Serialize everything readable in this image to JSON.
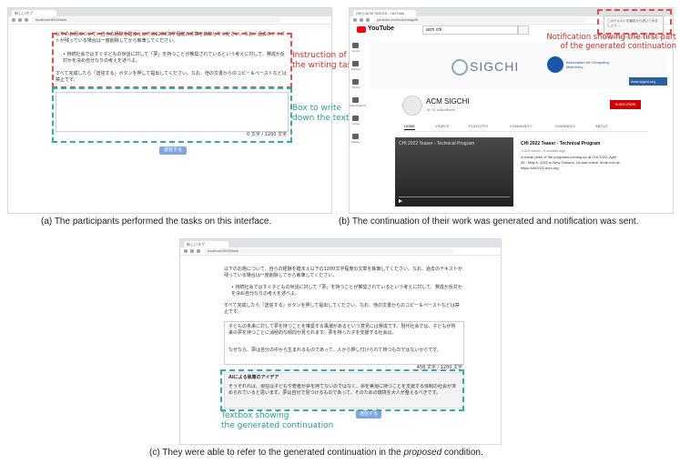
{
  "panel_a": {
    "browser": {
      "tab_label": "新しいタブ",
      "url": "localhost:8000/task"
    },
    "task_text_1": "以下のお題について、自らの経験を踏まえ以下の1200文字程度の文章を執筆してください。なお、過去のテキストが残っている場合は一度削除してから執筆してください。",
    "task_bullet": "持続社会ではすぐ子どもの世話に対して「夢」を持つことが推奨されているという考えに対して、賛成か反対かを決め自分なりの考えを述べよ。",
    "task_text_2": "すべて完成したら「送信する」ボタンを押して提出してください。なお、他の文書からのコピー＆ペーストなどは禁止です。",
    "counter": "0 文字 / 1200 文字",
    "submit_label": "送信する",
    "annotation_instruction": "Instruction of\nthe writing task",
    "annotation_textbox": "Box to write\ndown the text",
    "caption": "(a) The participants performed the tasks on this interface."
  },
  "panel_b": {
    "browser": {
      "tab_label": "(99+) ACM SIGCHI - YouTube",
      "url": "youtube.com/c/acmsigchi"
    },
    "search_value": "acm chi",
    "logo_text": "YouTube",
    "sidebar": [
      "Home",
      "Explore",
      "Shorts",
      "Subscriptions",
      "Library",
      "History"
    ],
    "banner_brand": "SIGCHI",
    "banner_acm": "Association for Computing Machinery",
    "banner_url": "www.sigchi.org",
    "channel_name": "ACM SIGCHI",
    "subscribers": "15.7K subscribers",
    "subscribe_label": "SUBSCRIBE",
    "tabs": [
      "HOME",
      "VIDEOS",
      "PLAYLISTS",
      "COMMUNITY",
      "CHANNELS",
      "ABOUT"
    ],
    "video_title": "CHI 2022 Teaser - Technical Program",
    "video_overlay": "CHI 2022 Teaser - Technical Program",
    "video_meta": "1,529 views • 6 months ago",
    "video_desc": "A sneak peek of the programs coming up at CHI 2022. April 30 - May 5, 2022 in New Orleans, LA and online. More info at: https://chi2022.acm.org",
    "notification_text": "このテキストを最初から書いてみましょう…",
    "annotation": "Notification showing the first part\nof the generated continuation",
    "caption": "(b) The continuation of their work was generated and notification was sent."
  },
  "panel_c": {
    "browser": {
      "tab_label": "新しいタブ",
      "url": "localhost:8000/task"
    },
    "task_text_1": "以下のお題について、自らの経験を踏まえ以下の1200文字程度の文章を執筆してください。なお、過去のテキストが残っている場合は一度削除してから執筆してください。",
    "task_bullet": "持続社会ではすぐ子どもの世話に対して「夢」を持つことが推奨されているという考えに対して、賛成か反対かを決め自分なりの考えを述べよ。",
    "task_text_2": "すべて完成したら「送信する」ボタンを押して提出してください。なお、他の文書からのコピー＆ペーストなどは禁止です。",
    "user_text_1": "子どもの未来に対して夢を持つことを推奨する風潮があるという意見には賛成です。現代社会では、子どもが将来の夢を持つことに消極的な傾向が見られます。夢を持った子を支援する社会は、",
    "user_text_2": "なぜなら、夢は自分の中から生まれるものであって、人から押し付けられて持つものではないからです。",
    "counter": "458 文字 / 1200 文字",
    "ai_title": "AIによる執筆のアイデア",
    "ai_text": "そうそれれば、現在は子どもや若者が夢を持てないのではなく、夢を実現に持つことを支援する体制の社会が求められていると思います。夢は自分で見つけるものであって、そのための環境を大人が整えるべきです。",
    "submit_label": "送信する",
    "annotation": "Textbox showing\nthe generated continuation",
    "caption_pre": "(c) They were able to refer to the generated continuation in the ",
    "caption_em": "proposed",
    "caption_post": " condition."
  },
  "colors": {
    "red_annotation": "#c9302c",
    "teal_annotation": "#2a9c97",
    "button": "#7ea7e0",
    "youtube_red": "#ff0000"
  }
}
